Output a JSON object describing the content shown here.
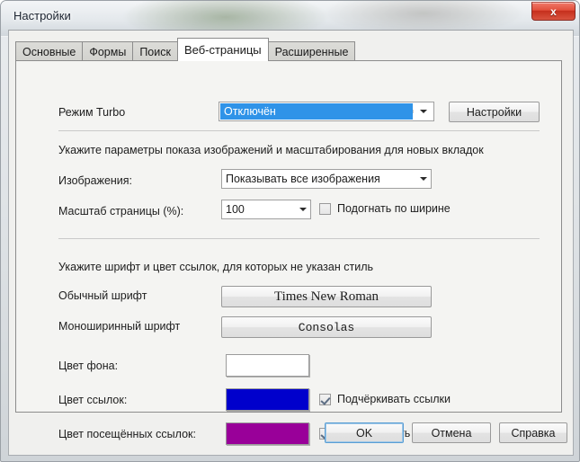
{
  "window": {
    "title": "Настройки",
    "close_label": "x"
  },
  "tabs": [
    {
      "label": "Основные",
      "active": false
    },
    {
      "label": "Формы",
      "active": false
    },
    {
      "label": "Поиск",
      "active": false
    },
    {
      "label": "Веб-страницы",
      "active": true
    },
    {
      "label": "Расширенные",
      "active": false
    }
  ],
  "turbo": {
    "label": "Режим Turbo",
    "value": "Отключён",
    "settings_button": "Настройки"
  },
  "images_section": {
    "heading": "Укажите параметры показа изображений и масштабирования для новых вкладок",
    "images_label": "Изображения:",
    "images_value": "Показывать все изображения",
    "zoom_label": "Масштаб страницы (%):",
    "zoom_value": "100",
    "fit_width_label": "Подогнать по ширине",
    "fit_width_checked": false
  },
  "fonts_section": {
    "heading": "Укажите шрифт и цвет ссылок, для которых не указан стиль",
    "normal_font_label": "Обычный шрифт",
    "normal_font_value": "Times New Roman",
    "mono_font_label": "Моноширинный шрифт",
    "mono_font_value": "Consolas"
  },
  "colors_section": {
    "background_label": "Цвет фона:",
    "background_color": "#ffffff",
    "link_label": "Цвет ссылок:",
    "link_color": "#0000cc",
    "visited_label": "Цвет посещённых ссылок:",
    "visited_color": "#990099",
    "underline_links_label": "Подчёркивать ссылки",
    "underline_links_checked": true,
    "underline_visited_label": "Подчёркивать посещённые",
    "underline_visited_checked": true
  },
  "footer": {
    "ok": "OK",
    "cancel": "Отмена",
    "help": "Справка"
  }
}
